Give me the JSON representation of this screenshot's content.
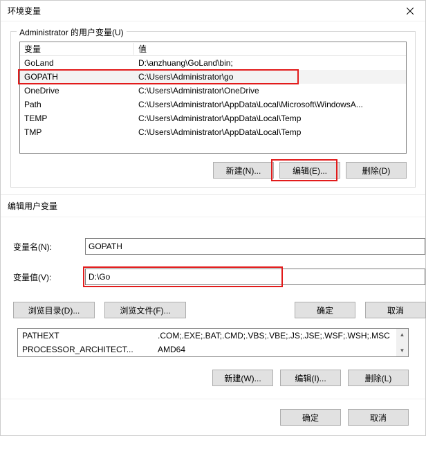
{
  "dialog1": {
    "title": "环境变量",
    "group_title": "Administrator 的用户变量(U)",
    "columns": {
      "name": "变量",
      "value": "值"
    },
    "rows": [
      {
        "name": "GoLand",
        "value": "D:\\anzhuang\\GoLand\\bin;",
        "selected": false
      },
      {
        "name": "GOPATH",
        "value": "C:\\Users\\Administrator\\go",
        "selected": true
      },
      {
        "name": "OneDrive",
        "value": "C:\\Users\\Administrator\\OneDrive",
        "selected": false
      },
      {
        "name": "Path",
        "value": "C:\\Users\\Administrator\\AppData\\Local\\Microsoft\\WindowsA...",
        "selected": false
      },
      {
        "name": "TEMP",
        "value": "C:\\Users\\Administrator\\AppData\\Local\\Temp",
        "selected": false
      },
      {
        "name": "TMP",
        "value": "C:\\Users\\Administrator\\AppData\\Local\\Temp",
        "selected": false
      }
    ],
    "buttons": {
      "new": "新建(N)...",
      "edit": "编辑(E)...",
      "delete": "删除(D)"
    }
  },
  "dialog2": {
    "title": "编辑用户变量",
    "name_label": "变量名(N):",
    "value_label": "变量值(V):",
    "name_value": "GOPATH",
    "value_value": "D:\\Go",
    "browse_dir": "浏览目录(D)...",
    "browse_file": "浏览文件(F)...",
    "ok": "确定",
    "cancel": "取消"
  },
  "sys_table": {
    "rows": [
      {
        "name": "PATHEXT",
        "value": ".COM;.EXE;.BAT;.CMD;.VBS;.VBE;.JS;.JSE;.WSF;.WSH;.MSC"
      },
      {
        "name": "PROCESSOR_ARCHITECT...",
        "value": "AMD64"
      }
    ],
    "buttons": {
      "new": "新建(W)...",
      "edit": "编辑(I)...",
      "delete": "删除(L)"
    }
  },
  "footer": {
    "ok": "确定",
    "cancel": "取消"
  }
}
